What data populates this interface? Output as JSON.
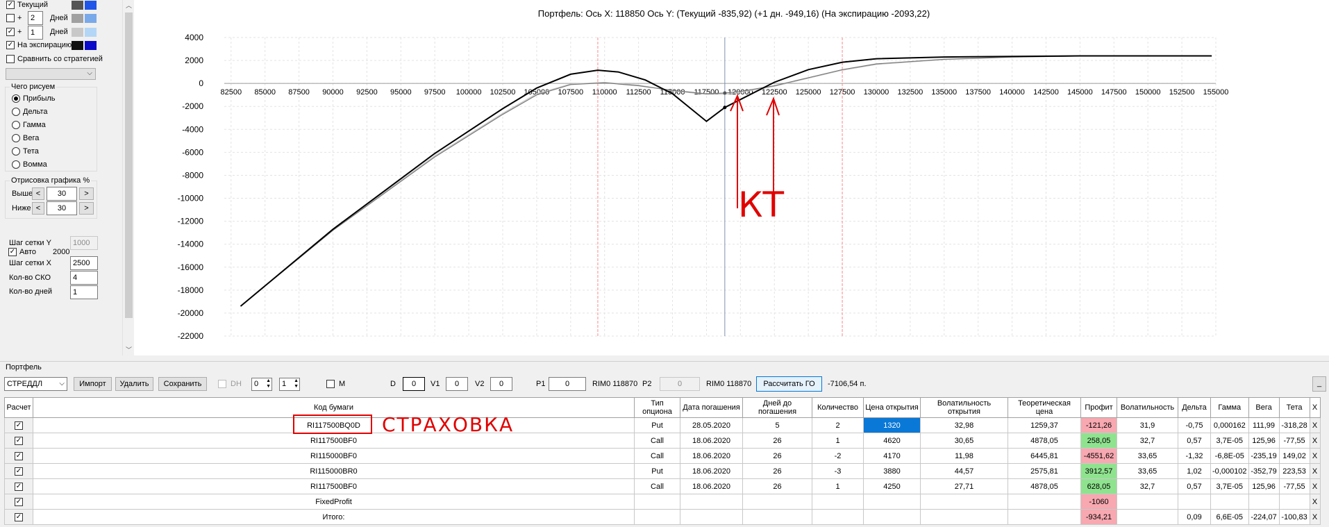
{
  "left_panel": {
    "rows": [
      {
        "label": "Текущий",
        "checked": true,
        "swatch_a": "#555555",
        "swatch_b": "#1f55e8"
      },
      {
        "label": "Дней",
        "checked": false,
        "plus": "+",
        "value": "2",
        "swatch_a": "#a0a0a0",
        "swatch_b": "#7aa9ea"
      },
      {
        "label": "Дней",
        "checked": true,
        "plus": "+",
        "value": "1",
        "swatch_a": "#c8c8c8",
        "swatch_b": "#b3d6f6"
      },
      {
        "label": "На экспирацию",
        "checked": true,
        "swatch_a": "#111111",
        "swatch_b": "#0a0ac8"
      }
    ],
    "compare_label": "Сравнить со стратегией",
    "what_group_title": "Чего рисуем",
    "what_options": [
      "Прибыль",
      "Дельта",
      "Гамма",
      "Вега",
      "Тета",
      "Вомма"
    ],
    "draw_group_title": "Отрисовка графика %",
    "above_label": "Выше",
    "above_value": "30",
    "below_label": "Ниже",
    "below_value": "30",
    "prev": "<",
    "next": ">",
    "grid_y_label": "Шаг сетки Y",
    "grid_y_value": "1000",
    "auto_label": "Авто",
    "auto_value": "2000",
    "grid_x_label": "Шаг сетки X",
    "grid_x_value": "2500",
    "sko_label": "Кол-во СКО",
    "sko_value": "4",
    "days_label": "Кол-во дней",
    "days_value": "1"
  },
  "chart_data": {
    "type": "line",
    "title": "Портфель: Ось X: 118850 Ось Y:  (Текущий -835,92)  (+1 дн. -949,16)  (На экспирацию -2093,22)",
    "xlim": [
      82000,
      155000
    ],
    "ylim": [
      -22000,
      4000
    ],
    "x_ticks": [
      82500,
      85000,
      87500,
      90000,
      92500,
      95000,
      97500,
      100000,
      102500,
      105000,
      107500,
      110000,
      112500,
      115000,
      117500,
      120000,
      122500,
      125000,
      127500,
      130000,
      132500,
      135000,
      137500,
      140000,
      142500,
      145000,
      147500,
      150000,
      152500,
      155000
    ],
    "y_ticks": [
      4000,
      2000,
      0,
      -2000,
      -4000,
      -6000,
      -8000,
      -10000,
      -12000,
      -14000,
      -16000,
      -18000,
      -20000,
      -22000
    ],
    "cursor_x": 118850,
    "red_lines": [
      109500,
      127500
    ],
    "series": [
      {
        "color": "#000000",
        "points": [
          [
            83200,
            -19400
          ],
          [
            90000,
            -12700
          ],
          [
            97500,
            -6100
          ],
          [
            102500,
            -2200
          ],
          [
            105000,
            -400
          ],
          [
            107500,
            800
          ],
          [
            109500,
            1150
          ],
          [
            111000,
            1000
          ],
          [
            113000,
            300
          ],
          [
            115000,
            -900
          ],
          [
            117500,
            -3300
          ],
          [
            118850,
            -2093
          ],
          [
            120000,
            -1400
          ],
          [
            122500,
            100
          ],
          [
            125000,
            1200
          ],
          [
            127500,
            1850
          ],
          [
            130000,
            2150
          ],
          [
            135000,
            2300
          ],
          [
            145000,
            2400
          ],
          [
            154700,
            2400
          ]
        ]
      },
      {
        "color": "#777777",
        "points": [
          [
            83200,
            -19400
          ],
          [
            90000,
            -12800
          ],
          [
            97500,
            -6400
          ],
          [
            102500,
            -2700
          ],
          [
            105000,
            -1000
          ],
          [
            107500,
            -100
          ],
          [
            110000,
            50
          ],
          [
            112500,
            -200
          ],
          [
            115000,
            -600
          ],
          [
            117500,
            -900
          ],
          [
            118850,
            -836
          ],
          [
            120000,
            -700
          ],
          [
            122500,
            -200
          ],
          [
            125000,
            500
          ],
          [
            127500,
            1200
          ],
          [
            130000,
            1700
          ],
          [
            135000,
            2100
          ],
          [
            140000,
            2300
          ],
          [
            145000,
            2380
          ],
          [
            154700,
            2400
          ]
        ]
      },
      {
        "color": "#c8c8c8",
        "points": [
          [
            83200,
            -19400
          ],
          [
            90000,
            -12750
          ],
          [
            97500,
            -6300
          ],
          [
            102500,
            -2600
          ],
          [
            105000,
            -900
          ],
          [
            107500,
            -50
          ],
          [
            110000,
            100
          ],
          [
            112500,
            -150
          ],
          [
            115000,
            -650
          ],
          [
            117500,
            -950
          ],
          [
            118850,
            -949
          ],
          [
            120000,
            -800
          ],
          [
            122500,
            -250
          ],
          [
            125000,
            450
          ],
          [
            127500,
            1150
          ],
          [
            130000,
            1650
          ],
          [
            135000,
            2080
          ],
          [
            140000,
            2290
          ],
          [
            145000,
            2380
          ],
          [
            154700,
            2400
          ]
        ]
      }
    ],
    "annotation_kt": "КТ"
  },
  "portfolio": {
    "section_title": "Портфель",
    "strategy_select": "СТРЕДДЛ",
    "import": "Импорт",
    "delete": "Удалить",
    "save": "Сохранить",
    "dh": "DH",
    "dh_a": "0",
    "dh_b": "1",
    "m": "M",
    "d_label": "D",
    "d_value": "0",
    "v1_label": "V1",
    "v1_value": "0",
    "v2_label": "V2",
    "v2_value": "0",
    "p1_label": "P1",
    "p1_value": "0",
    "rim1": "RIM0 118870",
    "p2_label": "P2",
    "p2_value": "0",
    "rim2": "RIM0 118870",
    "calc_go": "Рассчитать ГО",
    "go_value": "-7106,54 п.",
    "minimize": "_",
    "annotation_insurance": "СТРАХОВКА"
  },
  "table": {
    "headers": [
      "Расчет",
      "Код бумаги",
      "Тип опциона",
      "Дата погашения",
      "Дней до погашения",
      "Количество",
      "Цена открытия",
      "Волатильность открытия",
      "Теоретическая цена",
      "Профит",
      "Волатильность",
      "Дельта",
      "Гамма",
      "Вега",
      "Тета",
      "X"
    ],
    "rows": [
      {
        "code": "RI117500BQ0D",
        "type": "Put",
        "date": "28.05.2020",
        "days": "5",
        "qty": "2",
        "price": "1320",
        "vol_open": "32,98",
        "theo": "1259,37",
        "profit": "-121,26",
        "profit_state": "neg",
        "vol": "31,9",
        "delta": "-0,75",
        "gamma": "0,000162",
        "vega": "111,99",
        "theta": "-318,28",
        "x": "X",
        "price_selected": true
      },
      {
        "code": "RI117500BF0",
        "type": "Call",
        "date": "18.06.2020",
        "days": "26",
        "qty": "1",
        "price": "4620",
        "vol_open": "30,65",
        "theo": "4878,05",
        "profit": "258,05",
        "profit_state": "pos",
        "vol": "32,7",
        "delta": "0,57",
        "gamma": "3,7E-05",
        "vega": "125,96",
        "theta": "-77,55",
        "x": "X"
      },
      {
        "code": "RI115000BF0",
        "type": "Call",
        "date": "18.06.2020",
        "days": "26",
        "qty": "-2",
        "price": "4170",
        "vol_open": "11,98",
        "theo": "6445,81",
        "profit": "-4551,62",
        "profit_state": "neg",
        "vol": "33,65",
        "delta": "-1,32",
        "gamma": "-6,8E-05",
        "vega": "-235,19",
        "theta": "149,02",
        "x": "X"
      },
      {
        "code": "RI115000BR0",
        "type": "Put",
        "date": "18.06.2020",
        "days": "26",
        "qty": "-3",
        "price": "3880",
        "vol_open": "44,57",
        "theo": "2575,81",
        "profit": "3912,57",
        "profit_state": "pos",
        "vol": "33,65",
        "delta": "1,02",
        "gamma": "-0,000102",
        "vega": "-352,79",
        "theta": "223,53",
        "x": "X"
      },
      {
        "code": "RI117500BF0",
        "type": "Call",
        "date": "18.06.2020",
        "days": "26",
        "qty": "1",
        "price": "4250",
        "vol_open": "27,71",
        "theo": "4878,05",
        "profit": "628,05",
        "profit_state": "pos",
        "vol": "32,7",
        "delta": "0,57",
        "gamma": "3,7E-05",
        "vega": "125,96",
        "theta": "-77,55",
        "x": "X"
      },
      {
        "code": "FixedProfit",
        "type": "",
        "date": "",
        "days": "",
        "qty": "",
        "price": "",
        "vol_open": "",
        "theo": "",
        "profit": "-1060",
        "profit_state": "neg",
        "vol": "",
        "delta": "",
        "gamma": "",
        "vega": "",
        "theta": "",
        "x": "X"
      },
      {
        "code": "Итого:",
        "type": "",
        "date": "",
        "days": "",
        "qty": "",
        "price": "",
        "vol_open": "",
        "theo": "",
        "profit": "-934,21",
        "profit_state": "neg",
        "vol": "",
        "delta": "0,09",
        "gamma": "6,6E-05",
        "vega": "-224,07",
        "theta": "-100,83",
        "x": "X"
      }
    ]
  }
}
